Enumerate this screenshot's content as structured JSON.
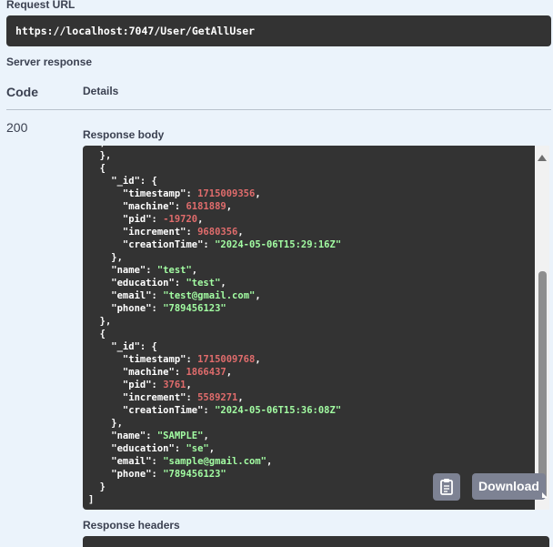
{
  "request_url": {
    "label": "Request URL",
    "value": "https://localhost:7047/User/GetAllUser"
  },
  "server_response": {
    "label": "Server response",
    "col_code": "Code",
    "col_details": "Details",
    "code": "200",
    "body_label": "Response body",
    "headers_label": "Response headers",
    "download_label": "Download"
  },
  "response_body": {
    "lines": [
      "  },",
      "  {",
      "    \"_id\": {",
      "      \"timestamp\": 1715009356,",
      "      \"machine\": 6181889,",
      "      \"pid\": -19720,",
      "      \"increment\": 9680356,",
      "      \"creationTime\": \"2024-05-06T15:29:16Z\"",
      "    },",
      "    \"name\": \"test\",",
      "    \"education\": \"test\",",
      "    \"email\": \"test@gmail.com\",",
      "    \"phone\": \"789456123\"",
      "  },",
      "  {",
      "    \"_id\": {",
      "      \"timestamp\": 1715009768,",
      "      \"machine\": 1866437,",
      "      \"pid\": 3761,",
      "      \"increment\": 5589271,",
      "      \"creationTime\": \"2024-05-06T15:36:08Z\"",
      "    },",
      "    \"name\": \"SAMPLE\",",
      "    \"education\": \"se\",",
      "    \"email\": \"sample@gmail.com\",",
      "    \"phone\": \"789456123\"",
      "  }",
      "]"
    ]
  },
  "icons": {
    "copy": "clipboard-icon",
    "scroll_up": "chevron-up-icon"
  },
  "colors": {
    "background": "#ebf3fb",
    "code_bg": "#333333",
    "number": "#e06c6c",
    "string": "#a2fca2",
    "button": "#7d8293"
  }
}
